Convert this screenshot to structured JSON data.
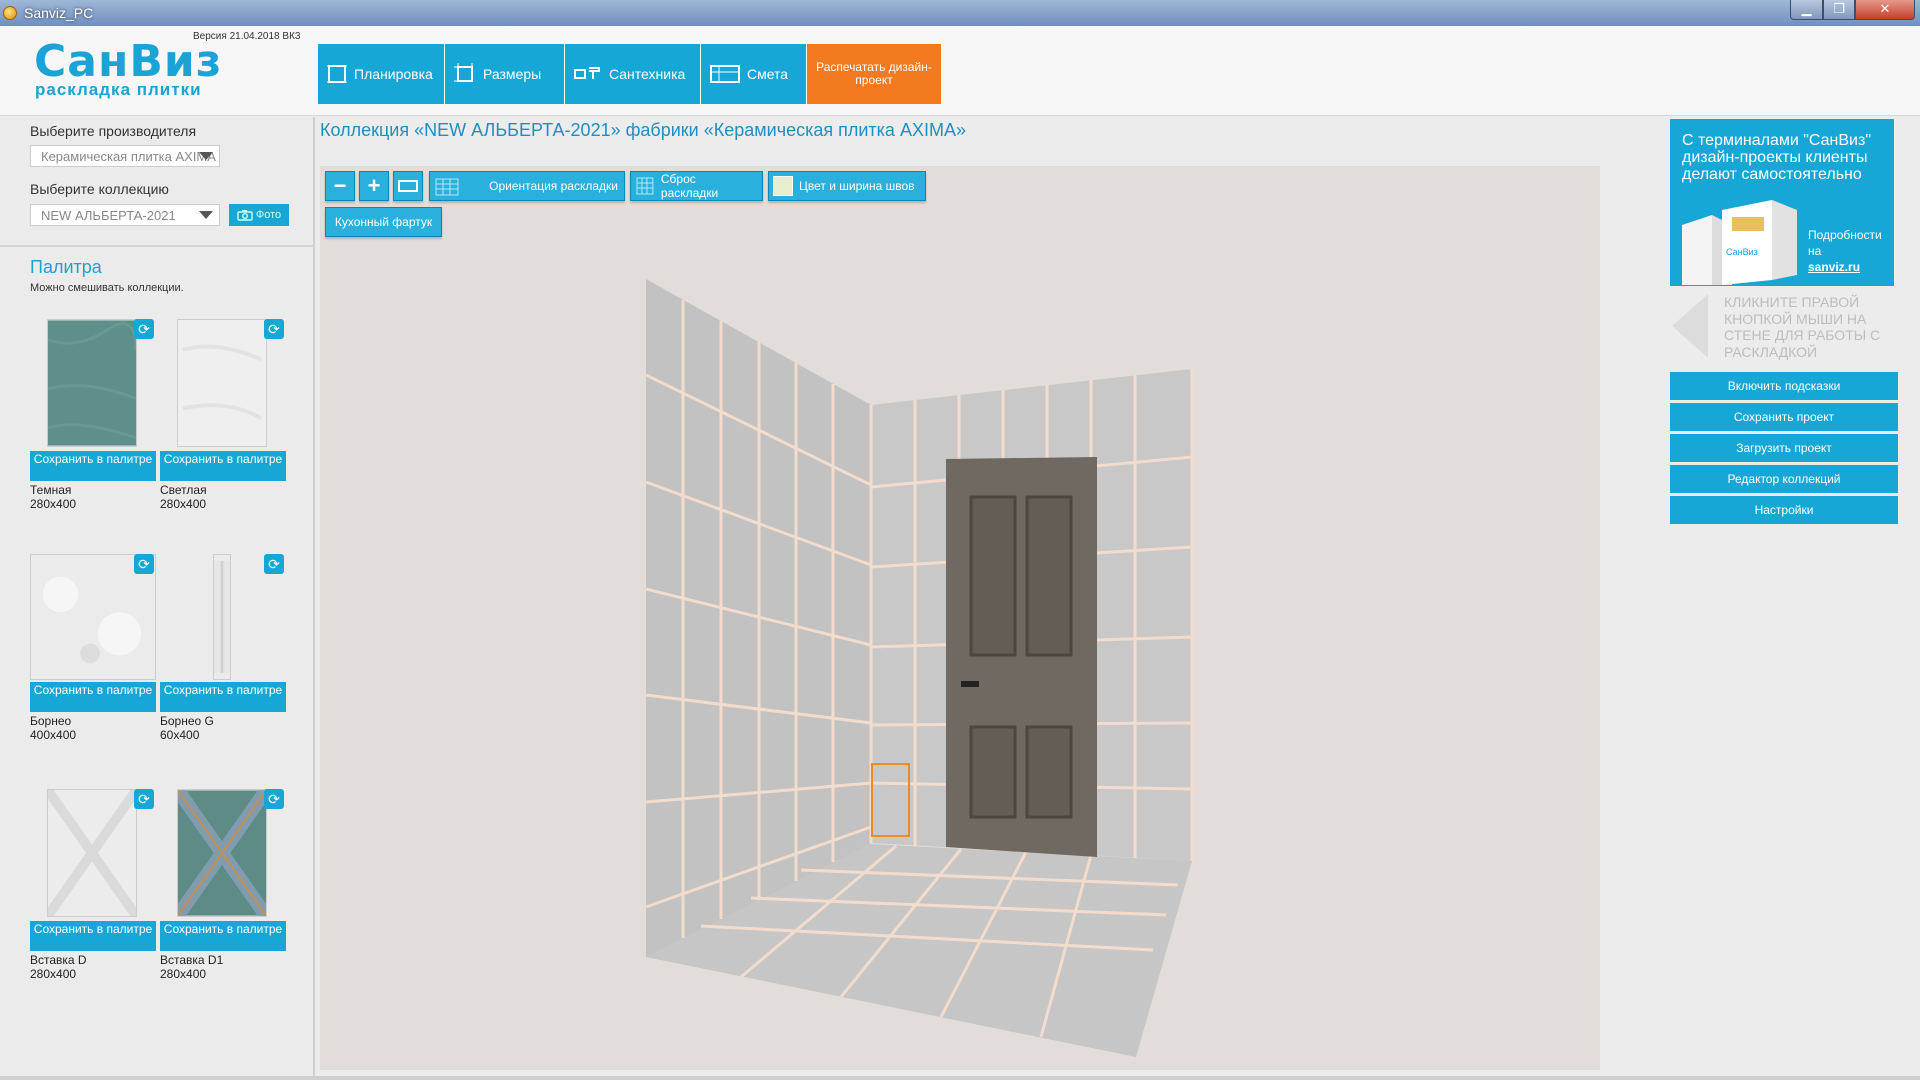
{
  "window": {
    "title": "Sanviz_PC",
    "minimize": "▁",
    "maximize": "❐",
    "close": "✕"
  },
  "header": {
    "logo": "СанВиз",
    "logo_sub": "раскладка плитки",
    "version": "Версия 21.04.2018 ВК3",
    "nav": [
      {
        "label": "Планировка",
        "icon": "layout-icon"
      },
      {
        "label": "Размеры",
        "icon": "dimensions-icon"
      },
      {
        "label": "Сантехника",
        "icon": "plumbing-icon"
      },
      {
        "label": "Смета",
        "icon": "estimate-icon"
      }
    ],
    "print": "Распечатать дизайн-проект"
  },
  "sidebar": {
    "manufacturer_label": "Выберите производителя",
    "manufacturer_value": "Керамическая плитка AXIMA",
    "collection_label": "Выберите коллекцию",
    "collection_value": "NEW АЛЬБЕРТА-2021",
    "photo": "Фото",
    "palette_title": "Палитра",
    "palette_sub": "Можно смешивать коллекции.",
    "save_label": "Сохранить в палитре",
    "tiles": [
      {
        "name": "Темная",
        "size": "280x400",
        "color": "#5f8f8a"
      },
      {
        "name": "Светлая",
        "size": "280x400",
        "color": "#eeeeee"
      },
      {
        "name": "Борнео",
        "size": "400x400",
        "color": "#e9e9e9"
      },
      {
        "name": "Борнео G",
        "size": "60x400",
        "color": "#e6e6e6"
      },
      {
        "name": "Вставка D",
        "size": "280x400",
        "color": "#ececec"
      },
      {
        "name": "Вставка D1",
        "size": "280x400",
        "color": "#5d8c86"
      }
    ]
  },
  "main": {
    "collection_title": "Коллекция «NEW АЛЬБЕРТА-2021» фабрики «Керамическая плитка AXIMA»",
    "tools": {
      "zoom_out": "−",
      "zoom_in": "+",
      "orientation": "Ориентация раскладки",
      "reset": "Сброс раскладки",
      "grout": "Цвет и ширина швов",
      "backsplash": "Кухонный фартук"
    },
    "colors": {
      "tile": "#c4c4c4",
      "grout": "#f3dccb",
      "door": "#6f6961",
      "accent": "#17a7d6"
    }
  },
  "right": {
    "ad_title": "С терминалами \"СанВиз\" дизайн-проекты клиенты делают самостоятельно",
    "ad_more": "Подробности на",
    "ad_link": "sanviz.ru",
    "hint": "КЛИКНИТЕ ПРАВОЙ КНОПКОЙ МЫШИ НА СТЕНЕ ДЛЯ РАБОТЫ С РАСКЛАДКОЙ",
    "buttons": [
      "Включить подсказки",
      "Сохранить проект",
      "Загрузить проект",
      "Редактор коллекций",
      "Настройки"
    ]
  }
}
